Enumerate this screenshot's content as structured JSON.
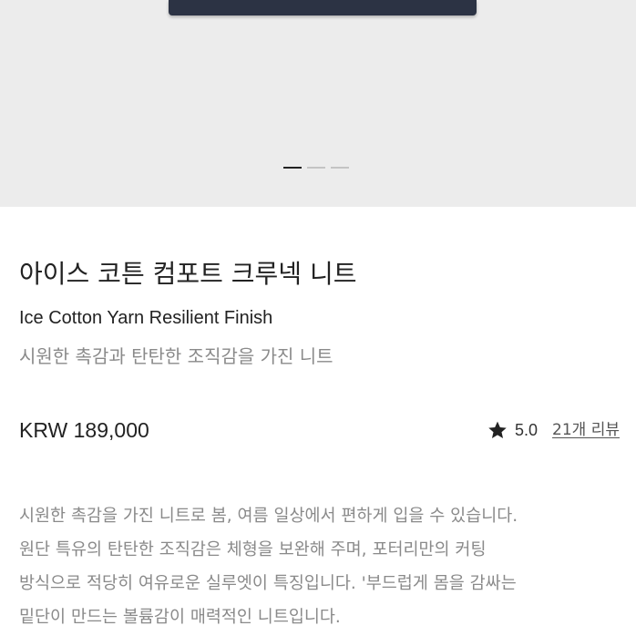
{
  "gallery": {
    "slide_count": 3,
    "active_index": 0
  },
  "product": {
    "title": "아이스 코튼 컴포트 크루넥 니트",
    "subtitle_en": "Ice Cotton Yarn Resilient Finish",
    "tagline": "시원한 촉감과 탄탄한 조직감을 가진 니트",
    "price": "KRW 189,000"
  },
  "rating": {
    "icon": "star-icon",
    "score": "5.0",
    "reviews_label": "21개 리뷰"
  },
  "description": {
    "lines": [
      "시원한 촉감을 가진 니트로 봄, 여름 일상에서 편하게 입을 수 있습니다.",
      "원단 특유의 탄탄한 조직감은 체형을 보완해 주며, 포터리만의 커팅",
      "방식으로 적당히 여유로운 실루엣이 특징입니다. '부드럽게 몸을 감싸는",
      "밑단이 만드는 볼륨감이 매력적인 니트입니다."
    ]
  },
  "colors": {
    "gallery_bg": "#ececec",
    "garment": "#2c3344",
    "text_primary": "#222222",
    "text_muted": "#8a8a8a"
  }
}
